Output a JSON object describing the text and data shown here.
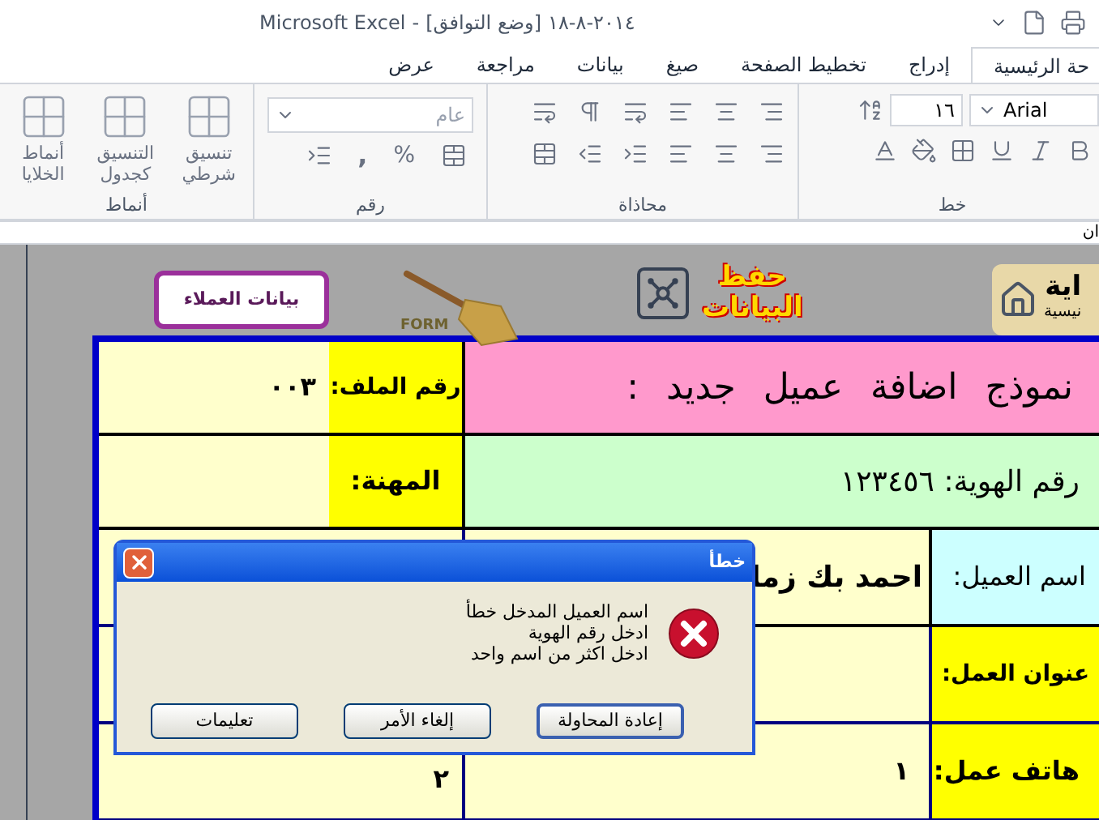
{
  "window": {
    "title_parts": [
      "٢٠١٤-٨-١٨",
      "[وضع التوافق]",
      "-",
      "Microsoft Excel"
    ]
  },
  "tabs": [
    {
      "label": "حة الرئيسية",
      "selected": true
    },
    {
      "label": "إدراج",
      "selected": false
    },
    {
      "label": "تخطيط الصفحة",
      "selected": false
    },
    {
      "label": "صيغ",
      "selected": false
    },
    {
      "label": "بيانات",
      "selected": false
    },
    {
      "label": "مراجعة",
      "selected": false
    },
    {
      "label": "عرض",
      "selected": false
    }
  ],
  "ribbon": {
    "font_group": {
      "label": "خط",
      "font_name": "Arial",
      "font_size": "١٦"
    },
    "alignment_group": {
      "label": "محاذاة"
    },
    "number_group": {
      "label": "رقم",
      "format": "عام",
      "percent": "%",
      "comma": ","
    },
    "styles_group": {
      "label": "أنماط",
      "buttons": [
        {
          "lines": [
            "تنسيق",
            "شرطي"
          ]
        },
        {
          "lines": [
            "التنسيق",
            "كجدول"
          ]
        },
        {
          "lines": [
            "أنماط",
            "الخلايا"
          ]
        }
      ]
    }
  },
  "formula_bar": {
    "value": "ان"
  },
  "sheet": {
    "home_logo": {
      "lines": [
        "اية",
        "نيسية"
      ]
    },
    "save_button": {
      "lines": [
        "حفظ",
        "البيانات"
      ]
    },
    "clear_form": {
      "caption": "FORM"
    },
    "customers_button": {
      "label": "بيانات العملاء"
    }
  },
  "form": {
    "title": "نموذج اضافة عميل جديد :",
    "file_label": "رقم الملف:",
    "file_value": "٠٠٣",
    "id_text": "رقم الهوية: ١٢٣٤٥٦",
    "profession_label": "المهنة:",
    "name_label": "اسم العميل:",
    "name_value": "احمد بك زما",
    "address_label": "عنوان العمل:",
    "phone_label": "هاتف عمل:",
    "phone_value": "١",
    "left_value": "٢"
  },
  "dialog": {
    "title": "خطأ",
    "message_lines": [
      "اسم العميل المدخل خطأ",
      "ادخل رقم الهوية",
      "ادخل اكثر من اسم واحد"
    ],
    "buttons": [
      {
        "label": "إعادة المحاولة",
        "selected": true
      },
      {
        "label": "إلغاء الأمر",
        "selected": false
      },
      {
        "label": "تعليمات",
        "selected": false
      }
    ]
  }
}
